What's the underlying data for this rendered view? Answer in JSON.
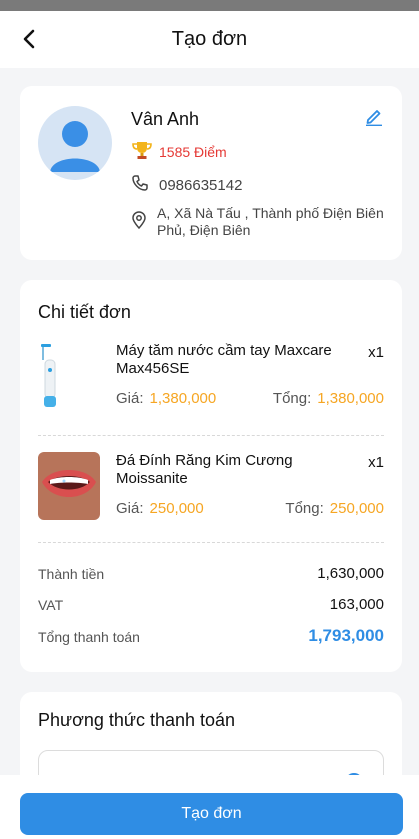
{
  "header": {
    "title": "Tạo đơn"
  },
  "customer": {
    "name": "Vân Anh",
    "points": "1585 Điểm",
    "phone": "0986635142",
    "address": "A, Xã Nà Tấu , Thành phố Điện Biên Phủ, Điện Biên"
  },
  "order": {
    "title": "Chi tiết đơn",
    "price_label": "Giá:",
    "total_label": "Tổng:",
    "items": [
      {
        "name": "Máy tăm nước cầm tay Maxcare Max456SE",
        "qty": "x1",
        "price": "1,380,000",
        "total": "1,380,000"
      },
      {
        "name": "Đá Đính Răng Kim Cương Moissanite",
        "qty": "x1",
        "price": "250,000",
        "total": "250,000"
      }
    ],
    "summary": {
      "subtotal_label": "Thành tiền",
      "subtotal": "1,630,000",
      "vat_label": "VAT",
      "vat": "163,000",
      "grand_label": "Tổng thanh toán",
      "grand": "1,793,000"
    }
  },
  "payment": {
    "title": "Phương thức thanh toán"
  },
  "footer": {
    "submit_label": "Tạo đơn"
  },
  "colors": {
    "accent": "#2f8de4",
    "price": "#f6a623",
    "points": "#e53935"
  }
}
